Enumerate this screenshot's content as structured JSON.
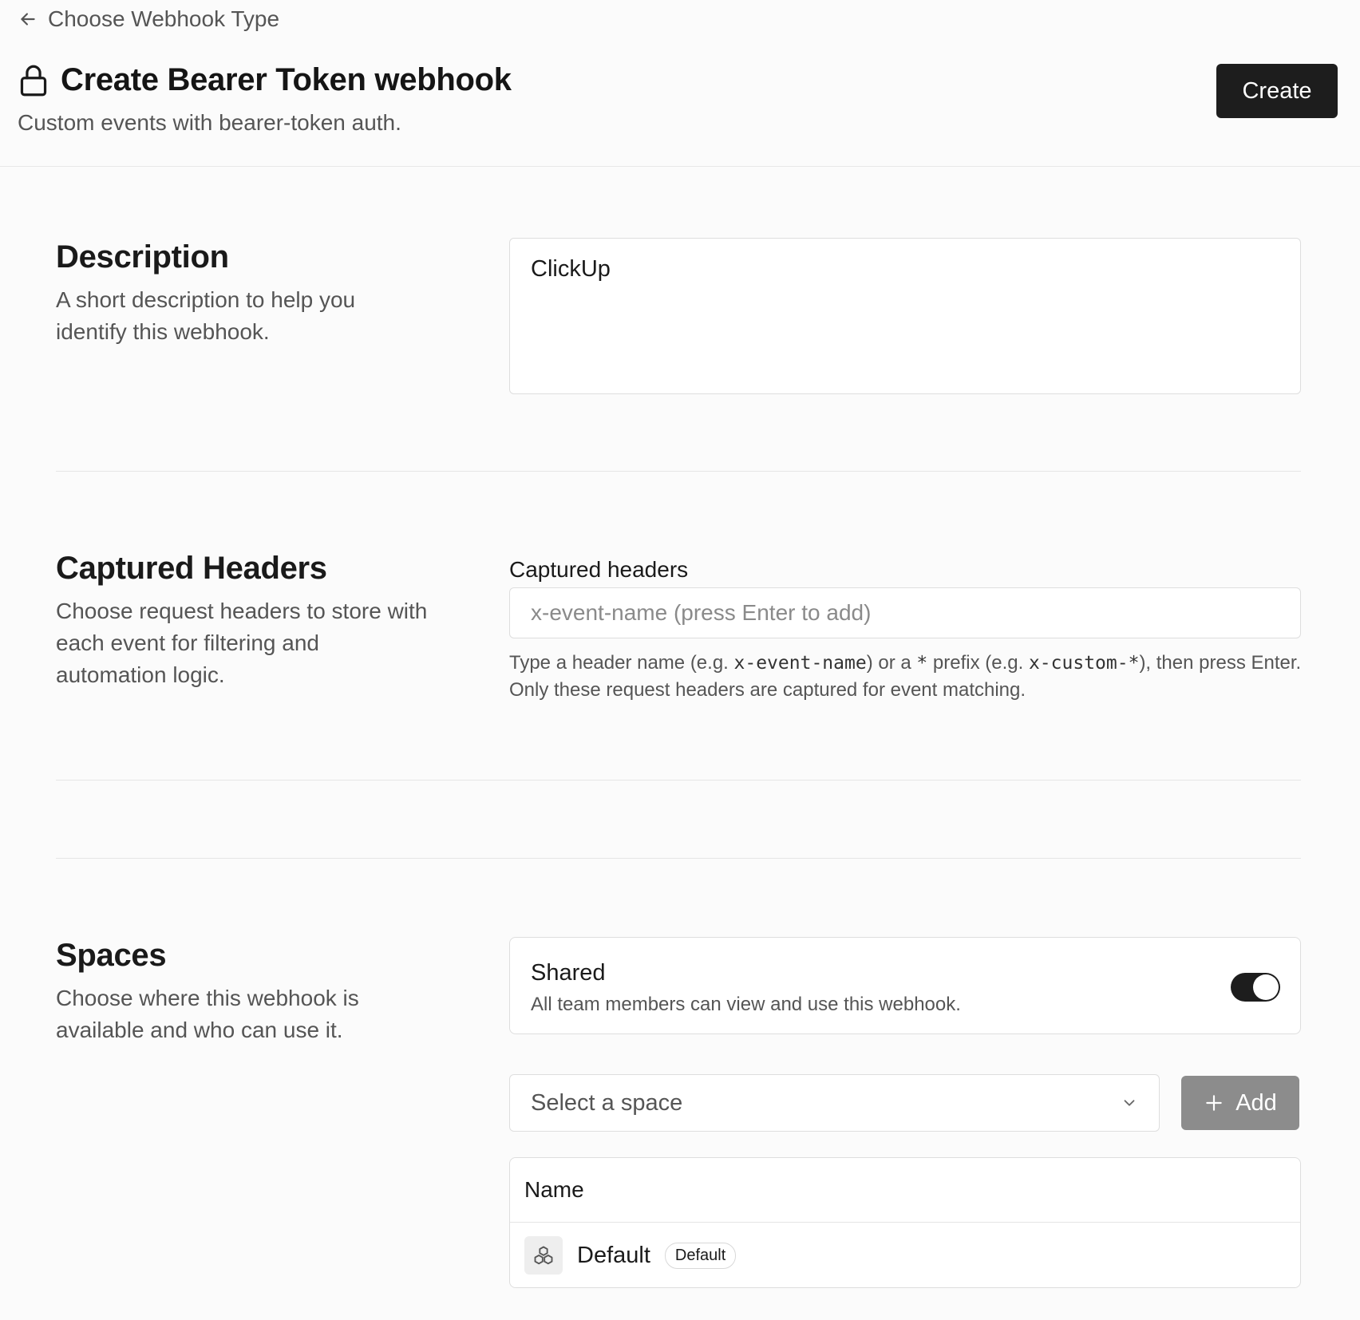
{
  "nav": {
    "back_label": "Choose Webhook Type"
  },
  "header": {
    "title": "Create Bearer Token webhook",
    "subtitle": "Custom events with bearer-token auth.",
    "create_label": "Create"
  },
  "description_section": {
    "title": "Description",
    "desc": "A short description to help you identify this webhook.",
    "value": "ClickUp"
  },
  "headers_section": {
    "title": "Captured Headers",
    "desc": "Choose request headers to store with each event for filtering and automation logic.",
    "field_label": "Captured headers",
    "placeholder": "x-event-name (press Enter to add)",
    "help_1": "Type a header name (e.g. ",
    "help_code_1": "x-event-name",
    "help_2": ") or a ",
    "help_code_2": "*",
    "help_3": " prefix (e.g. ",
    "help_code_3": "x-custom-*",
    "help_4": "), then press Enter. Only these request headers are captured for event matching."
  },
  "spaces_section": {
    "title": "Spaces",
    "desc": "Choose where this webhook is available and who can use it.",
    "shared": {
      "title": "Shared",
      "desc": "All team members can view and use this webhook.",
      "enabled": true
    },
    "select_value": "Select a space",
    "add_label": "Add",
    "table": {
      "header": "Name",
      "rows": [
        {
          "name": "Default",
          "badge": "Default"
        }
      ]
    }
  },
  "icons": [
    "arrow-left-icon",
    "lock-icon",
    "chevron-down-icon",
    "plus-icon",
    "boxes-icon"
  ],
  "colors": {
    "primary_button": "#1d1d1d",
    "disabled_button": "#8c8c8c",
    "background": "#fbfbfb"
  }
}
